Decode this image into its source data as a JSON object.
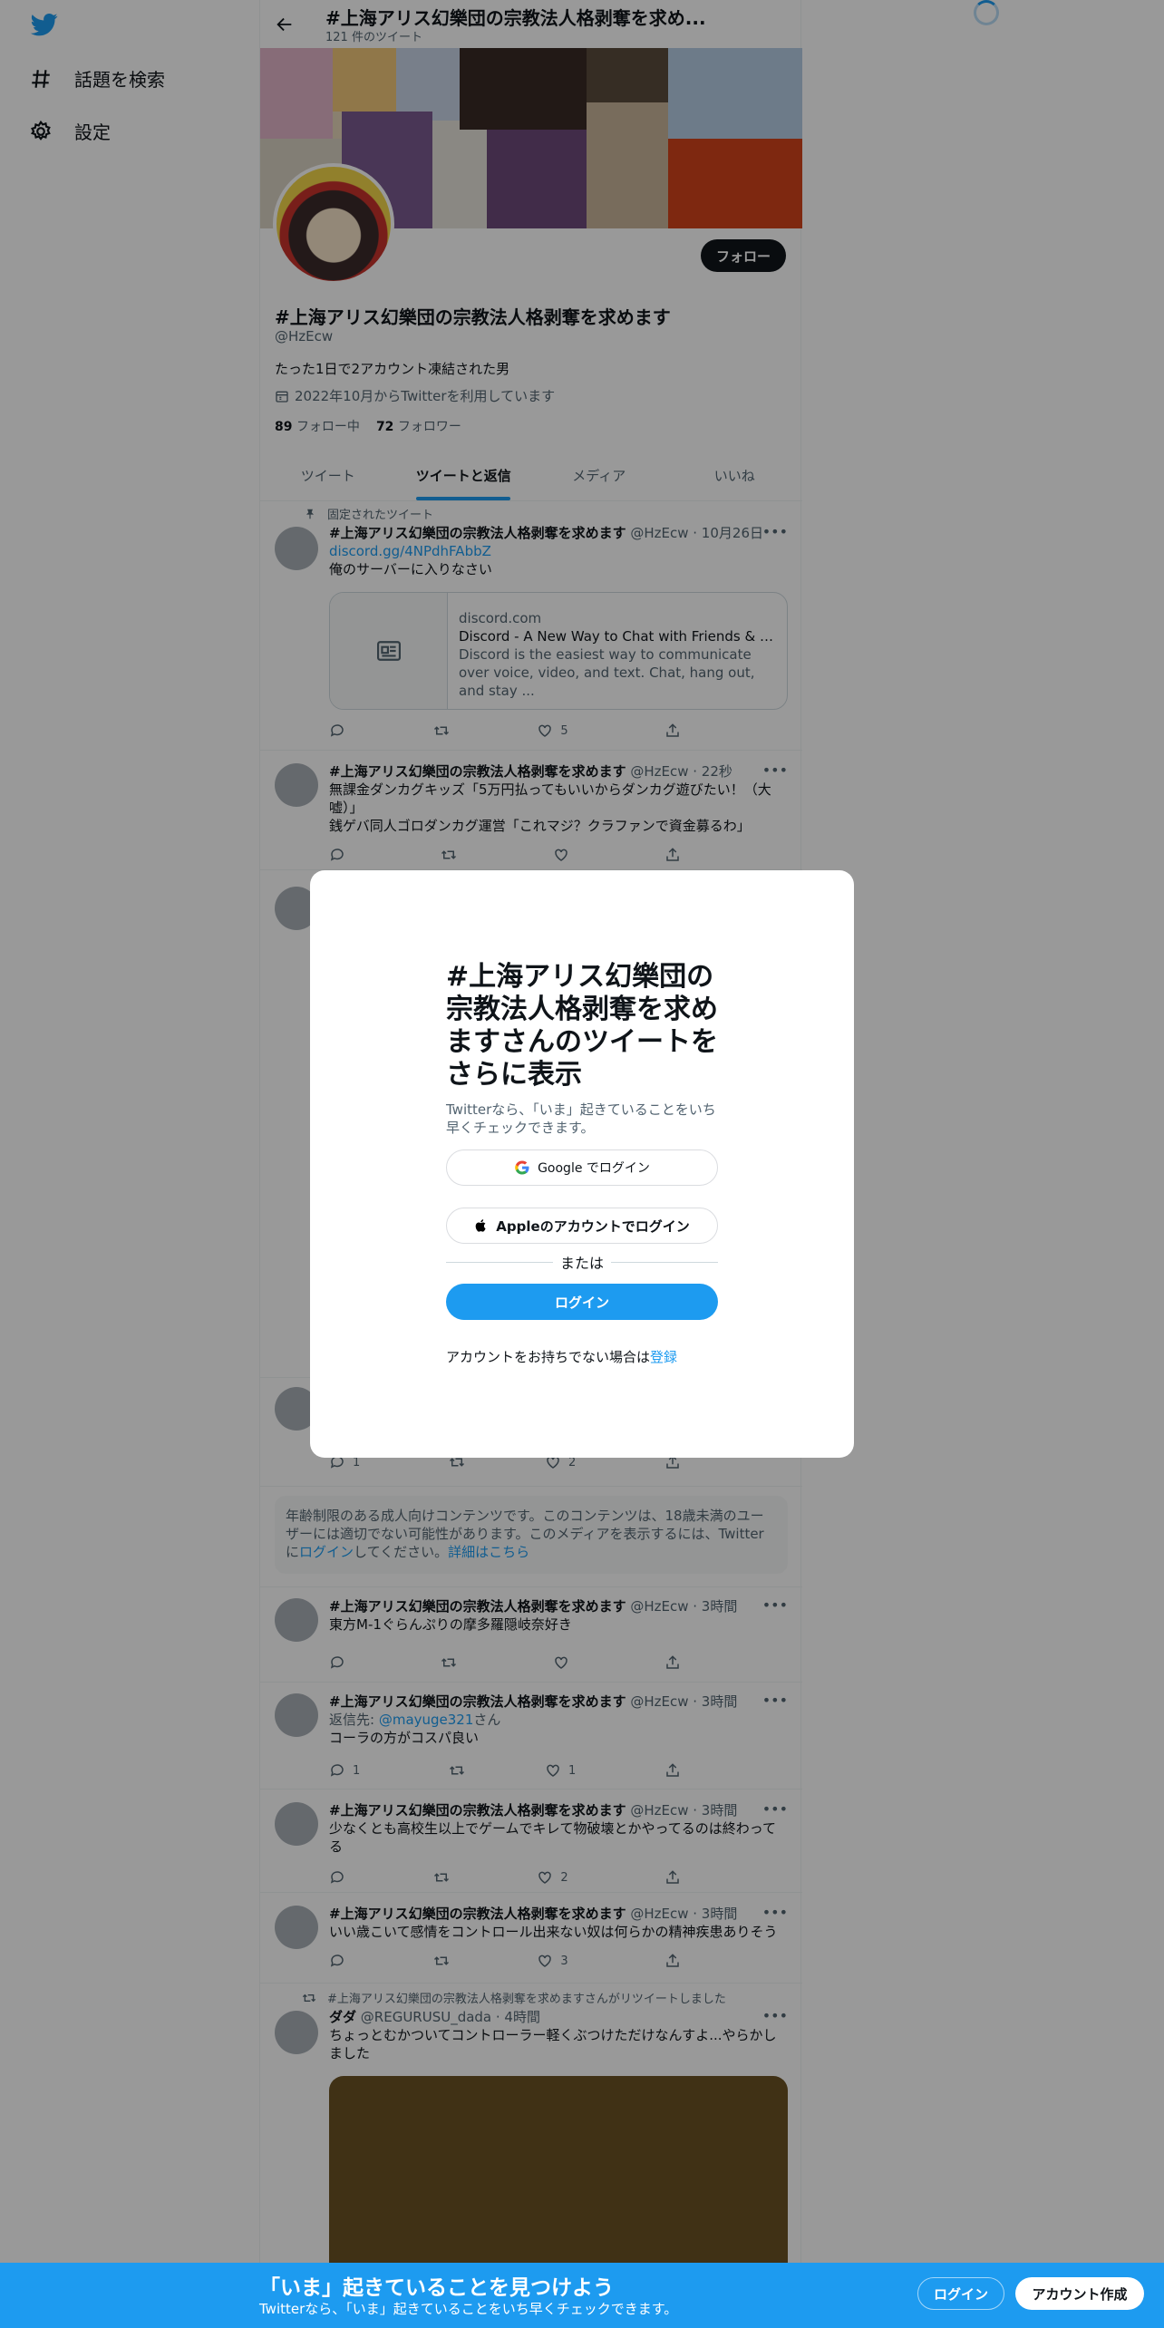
{
  "nav": {
    "explore_label": "話題を検索",
    "settings_label": "設定"
  },
  "header": {
    "title": "#上海アリス幻樂団の宗教法人格剥奪を求め...",
    "tweet_count": "121 件のツイート"
  },
  "profile": {
    "name": "#上海アリス幻樂団の宗教法人格剥奪を求めます",
    "handle": "@HzEcw",
    "bio": "たった1日で2アカウント凍結された男",
    "joined": "2022年10月からTwitterを利用しています",
    "following_count": "89",
    "following_label": "フォロー中",
    "followers_count": "72",
    "followers_label": "フォロワー",
    "follow_button": "フォロー"
  },
  "tabs": [
    "ツイート",
    "ツイートと返信",
    "メディア",
    "いいね"
  ],
  "pinned_label": "固定されたツイート",
  "tweets": [
    {
      "author": "#上海アリス幻樂団の宗教法人格剥奪を求めます",
      "meta": "@HzEcw · 10月26日",
      "link": "discord.gg/4NPdhFAbbZ",
      "text": "俺のサーバーに入りなさい",
      "card_domain": "discord.com",
      "card_title": "Discord - A New Way to Chat with Friends & Com...",
      "card_desc": "Discord is the easiest way to communicate over voice, video, and text. Chat, hang out, and stay ...",
      "likes": "5"
    },
    {
      "author": "#上海アリス幻樂団の宗教法人格剥奪を求めます",
      "meta": "@HzEcw · 22秒",
      "text": "無課金ダンカグキッズ「5万円払ってもいいからダンカグ遊びたい！（大嘘）」",
      "text2": "銭ゲバ同人ゴロダンカグ運営「これマジ？クラファンで資金募るわ」"
    },
    {
      "replies": "1",
      "likes": "2"
    },
    {
      "author": "#上海アリス幻樂団の宗教法人格剥奪を求めます",
      "meta": "@HzEcw · 3時間",
      "text": "東方M-1ぐらんぷりの摩多羅隠岐奈好き"
    },
    {
      "author": "#上海アリス幻樂団の宗教法人格剥奪を求めます",
      "meta": "@HzEcw · 3時間",
      "reply_prefix": "返信先: ",
      "reply_to": "@mayuge321",
      "reply_suffix": "さん",
      "text": "コーラの方がコスパ良い",
      "replies": "1",
      "likes": "1"
    },
    {
      "author": "#上海アリス幻樂団の宗教法人格剥奪を求めます",
      "meta": "@HzEcw · 3時間",
      "text": "少なくとも高校生以上でゲームでキレて物破壊とかやってるのは終わってる",
      "likes": "2"
    },
    {
      "author": "#上海アリス幻樂団の宗教法人格剥奪を求めます",
      "meta": "@HzEcw · 3時間",
      "text": "いい歳こいて感情をコントロール出来ない奴は何らかの精神疾患ありそう",
      "likes": "3"
    },
    {
      "retweet_label": "#上海アリス幻樂団の宗教法人格剥奪を求めますさんがリツイートしました",
      "author": "ダダ",
      "meta": "@REGURUSU_dada · 4時間",
      "text": "ちょっとむかついてコントローラー軽くぶつけただけなんすよ...やらかしました"
    }
  ],
  "age_notice": {
    "text": "年齢制限のある成人向けコンテンツです。このコンテンツは、18歳未満のユーザーには適切でない可能性があります。このメディアを表示するには、Twitterに",
    "login_link": "ログイン",
    "text2": "してください。",
    "learn_more": "詳細はこちら"
  },
  "modal": {
    "title": "#上海アリス幻樂団の宗教法人格剥奪を求めますさんのツイートをさらに表示",
    "subtitle": "Twitterなら、「いま」起きていることをいち早くチェックできます。",
    "google_label": "Google でログイン",
    "apple_label": "Appleのアカウントでログイン",
    "or_label": "または",
    "login_label": "ログイン",
    "signup_prompt": "アカウントをお持ちでない場合は",
    "signup_link": "登録"
  },
  "bottom_bar": {
    "title": "「いま」起きていることを見つけよう",
    "subtitle": "Twitterなら、「いま」起きていることをいち早くチェックできます。",
    "login_label": "ログイン",
    "signup_label": "アカウント作成"
  },
  "colors": {
    "accent": "#1d9bf0",
    "text": "#0f1419",
    "muted": "#536471"
  }
}
